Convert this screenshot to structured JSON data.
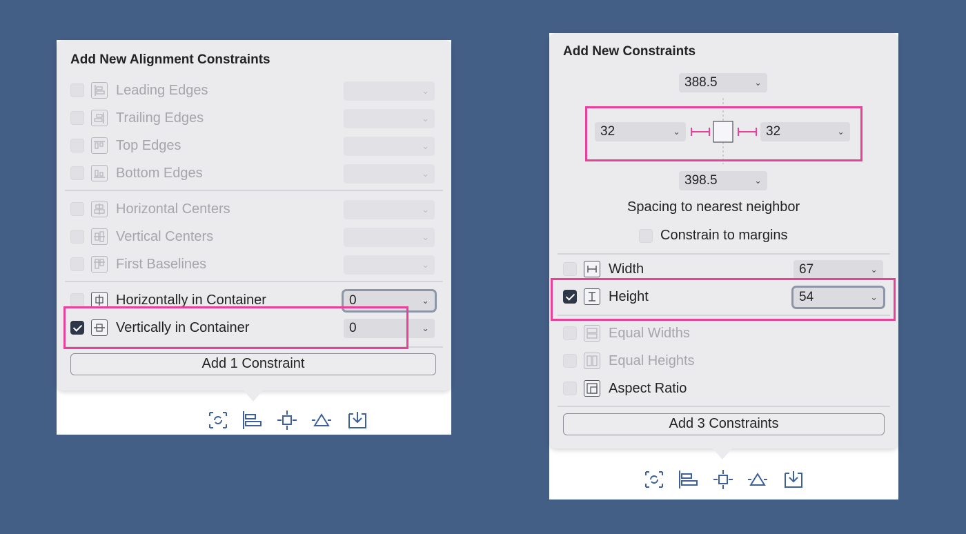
{
  "left_panel": {
    "title": "Add New Alignment Constraints",
    "items": [
      {
        "label": "Leading Edges",
        "value": "",
        "checked": false,
        "enabled": false
      },
      {
        "label": "Trailing Edges",
        "value": "",
        "checked": false,
        "enabled": false
      },
      {
        "label": "Top Edges",
        "value": "",
        "checked": false,
        "enabled": false
      },
      {
        "label": "Bottom Edges",
        "value": "",
        "checked": false,
        "enabled": false
      },
      {
        "label": "Horizontal Centers",
        "value": "",
        "checked": false,
        "enabled": false
      },
      {
        "label": "Vertical Centers",
        "value": "",
        "checked": false,
        "enabled": false
      },
      {
        "label": "First Baselines",
        "value": "",
        "checked": false,
        "enabled": false
      },
      {
        "label": "Horizontally in Container",
        "value": "0",
        "checked": false,
        "enabled": true
      },
      {
        "label": "Vertically in Container",
        "value": "0",
        "checked": true,
        "enabled": true
      }
    ],
    "add_button": "Add 1 Constraint"
  },
  "right_panel": {
    "title": "Add New Constraints",
    "top_value": "388.5",
    "left_value": "32",
    "right_value": "32",
    "bottom_value": "398.5",
    "spacing_label": "Spacing to nearest neighbor",
    "constrain_margins_label": "Constrain to margins",
    "constrain_margins_checked": false,
    "items": [
      {
        "label": "Width",
        "value": "67",
        "checked": false,
        "enabled": true
      },
      {
        "label": "Height",
        "value": "54",
        "checked": true,
        "enabled": true
      },
      {
        "label": "Equal Widths",
        "checked": false,
        "enabled": false
      },
      {
        "label": "Equal Heights",
        "checked": false,
        "enabled": false
      },
      {
        "label": "Aspect Ratio",
        "checked": false,
        "enabled": true
      }
    ],
    "add_button": "Add 3 Constraints"
  },
  "toolbar_icons": [
    "update-frames-icon",
    "align-icon",
    "add-constraints-icon",
    "resolve-issues-icon",
    "embed-in-icon"
  ],
  "colors": {
    "background": "#445f86",
    "highlight": "#ec3f9a",
    "popover": "#ebeaed"
  }
}
